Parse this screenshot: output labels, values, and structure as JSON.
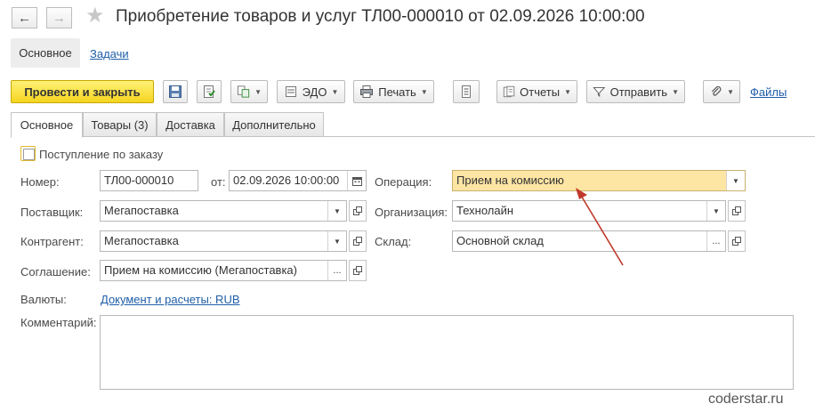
{
  "window": {
    "title": "Приобретение товаров и услуг ТЛ00-000010 от 02.09.2026 10:00:00"
  },
  "sections": {
    "main": "Основное",
    "tasks": "Задачи"
  },
  "toolbar": {
    "post_close": "Провести и закрыть",
    "edo": "ЭДО",
    "print": "Печать",
    "reports": "Отчеты",
    "send": "Отправить",
    "files": "Файлы"
  },
  "tabs": [
    {
      "label": "Основное",
      "active": true
    },
    {
      "label": "Товары (3)",
      "active": false
    },
    {
      "label": "Доставка",
      "active": false
    },
    {
      "label": "Дополнительно",
      "active": false
    }
  ],
  "form": {
    "by_order": {
      "label": "Поступление по заказу",
      "checked": false
    },
    "number": {
      "label": "Номер:",
      "value": "ТЛ00-000010"
    },
    "date": {
      "label": "от:",
      "value": "02.09.2026 10:00:00"
    },
    "operation": {
      "label": "Операция:",
      "value": "Прием на комиссию"
    },
    "supplier": {
      "label": "Поставщик:",
      "value": "Мегапоставка"
    },
    "organization": {
      "label": "Организация:",
      "value": "Технолайн"
    },
    "counterparty": {
      "label": "Контрагент:",
      "value": "Мегапоставка"
    },
    "warehouse": {
      "label": "Склад:",
      "value": "Основной склад"
    },
    "agreement": {
      "label": "Соглашение:",
      "value": "Прием на комиссию (Мегапоставка)"
    },
    "currency": {
      "label": "Валюты:",
      "value": "Документ и расчеты: RUB"
    },
    "comment": {
      "label": "Комментарий:",
      "value": ""
    }
  },
  "colors": {
    "primary_button": "#f5d41f",
    "highlight_field": "#fde5a4",
    "link": "#1f5ea8",
    "arrow": "#c0392b"
  },
  "watermark": "coderstar.ru"
}
